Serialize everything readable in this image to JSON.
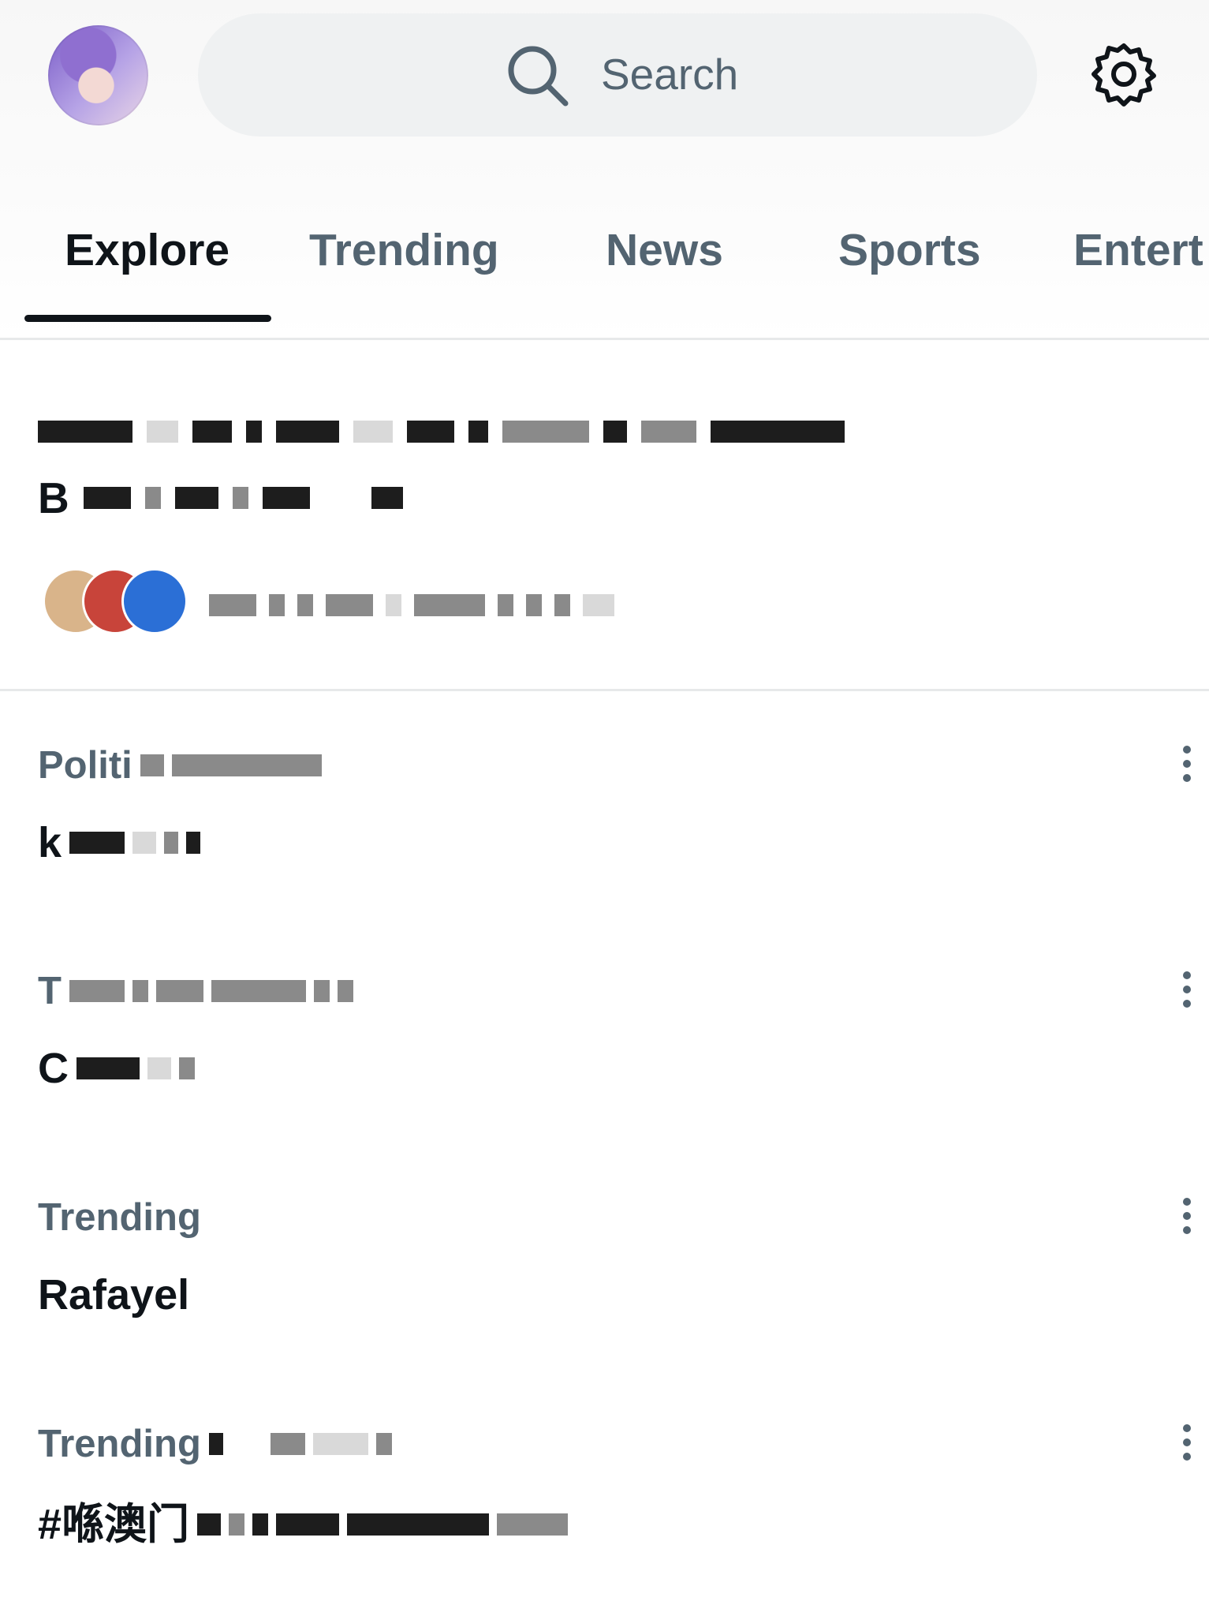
{
  "search": {
    "placeholder": "Search"
  },
  "tabs": [
    "Explore",
    "Trending",
    "News",
    "Sports",
    "Entert"
  ],
  "featured": {
    "line2_start": "B"
  },
  "trends": [
    {
      "category": "Politi",
      "title": "k"
    },
    {
      "category": "T",
      "title": "C"
    },
    {
      "category": "Trending",
      "title": "Rafayel"
    },
    {
      "category": "Trending",
      "title": "#喺澳门"
    }
  ]
}
